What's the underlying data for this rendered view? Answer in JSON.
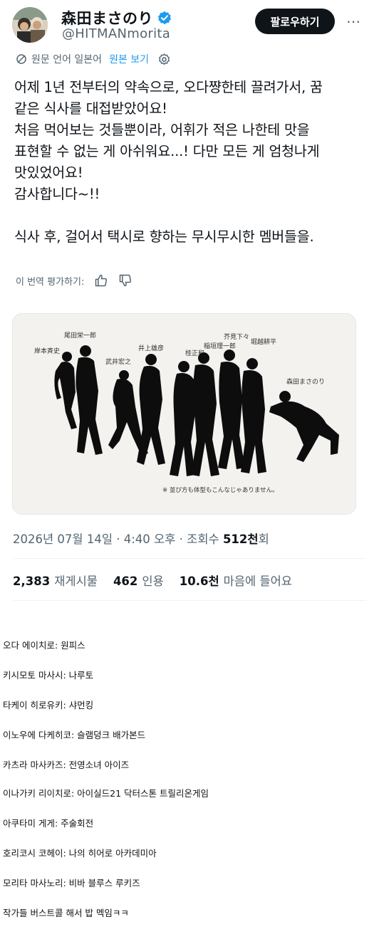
{
  "author": {
    "display_name": "森田まさのり",
    "handle": "@HITMANmorita",
    "follow_label": "팔로우하기"
  },
  "translation": {
    "source_label": "원문 언어 일본어",
    "view_original": "원본 보기"
  },
  "tweet": {
    "text": "어제 1년 전부터의 약속으로, 오다쨩한테 끌려가서, 꿈\n같은 식사를 대접받았어요!\n처음 먹어보는 것들뿐이라, 어휘가 적은 나한테 맛을\n표현할 수 없는 게 아쉬워요...! 다만 모든 게 엄청나게\n맛있었어요!\n감사합니다~!!\n\n식사 후, 걸어서 택시로 향하는 무시무시한 멤버들을."
  },
  "rate": {
    "label": "이 번역 평가하기:"
  },
  "media": {
    "labels": [
      "岸本斉史",
      "尾田栄一郎",
      "武井宏之",
      "井上雄彦",
      "桂正和",
      "稲垣理一郎",
      "芥見下々",
      "堀越耕平",
      "森田まさのり"
    ],
    "caption": "※ 並び方も体型もこんなじゃありません。"
  },
  "meta": {
    "datetime": "2026년 07월 14일 · 4:40 오후 · 조회수 ",
    "views": "512천",
    "views_suffix": "회"
  },
  "stats": {
    "reposts_num": "2,383",
    "reposts_label": "재게시물",
    "quotes_num": "462",
    "quotes_label": "인용",
    "likes_num": "10.6천",
    "likes_label": "마음에 들어요"
  },
  "notes": [
    "오다 에이치로: 원피스",
    "키시모토 마사시: 나루토",
    "타케이 히로유키: 샤먼킹",
    "이노우에 다케히코: 슬램덩크 배가본드",
    "카츠라 마사카즈: 전영소녀 아이즈",
    "이나가키 리이치로: 아이실드21 닥터스톤 트릴리온게임",
    "아쿠타미 게게: 주술회전",
    "호리코시 코헤이: 나의 히어로 아카데미아",
    "모리타 마사노리: 비바 블루스 루키즈",
    "작가들 버스트콜 해서 밥 멕임ㅋㅋ"
  ],
  "colors": {
    "accent": "#1d9bf0",
    "muted": "#536471",
    "text": "#0f1419"
  }
}
